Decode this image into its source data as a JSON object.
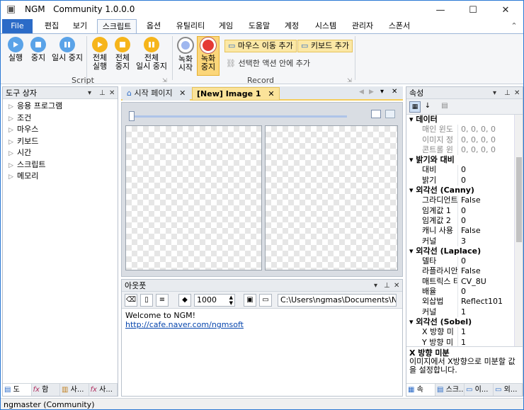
{
  "window": {
    "app_name": "NGM",
    "title": "Community 1.0.0.0",
    "minimize": "—",
    "maximize": "☐",
    "close": "✕"
  },
  "menu": {
    "file": "File",
    "tabs": [
      "편집",
      "보기",
      "스크립트",
      "옵션",
      "유틸리티",
      "게임",
      "도움말",
      "계정",
      "시스템",
      "관리자",
      "스폰서"
    ],
    "active_tab": "스크립트",
    "collapse": "⌃"
  },
  "ribbon": {
    "script_group": {
      "label": "Script",
      "buttons": [
        {
          "label": "실행"
        },
        {
          "label": "중지"
        },
        {
          "label": "일시 중지"
        },
        {
          "label": "전체\n실행"
        },
        {
          "label": "전체\n중지"
        },
        {
          "label": "전체\n일시 중지"
        }
      ]
    },
    "record_group": {
      "label": "Record",
      "record_start": "녹화\n시작",
      "record_stop": "녹화\n중지",
      "add_mouse_move": "마우스 이동 추가",
      "add_keyboard": "키보드 추가",
      "add_in_selected_action": "선택한 액션 안에 추가"
    }
  },
  "toolbox": {
    "title": "도구 상자",
    "items": [
      "응용 프로그램",
      "조건",
      "마우스",
      "키보드",
      "시간",
      "스크립트",
      "메모리"
    ],
    "bottom_tabs": [
      "도",
      "함",
      "사...",
      "사..."
    ]
  },
  "documents": {
    "tabs": [
      {
        "label": "시작 페이지"
      },
      {
        "label": "[New] Image 1"
      }
    ],
    "active": "[New] Image 1"
  },
  "output": {
    "title": "아웃풋",
    "number_value": "1000",
    "path_value": "C:\\Users\\ngmas\\Documents\\NGM5\\",
    "welcome_text": "Welcome to NGM!",
    "link_text": "http://cafe.naver.com/ngmsoft"
  },
  "properties": {
    "title": "속성",
    "categories": [
      {
        "name": "데이터",
        "rows": [
          [
            "매인 윈도",
            "0, 0, 0, 0"
          ],
          [
            "이미지 정",
            "0, 0, 0, 0"
          ],
          [
            "콘트롤 윈",
            "0, 0, 0, 0"
          ]
        ],
        "dim": true
      },
      {
        "name": "밝기와 대비",
        "rows": [
          [
            "대비",
            "0"
          ],
          [
            "밝기",
            "0"
          ]
        ]
      },
      {
        "name": "외각선 (Canny)",
        "rows": [
          [
            "그라디언트",
            "False"
          ],
          [
            "임계값 1",
            "0"
          ],
          [
            "임계값 2",
            "0"
          ],
          [
            "캐니 사용",
            "False"
          ],
          [
            "커널",
            "3"
          ]
        ]
      },
      {
        "name": "외각선 (Laplace)",
        "rows": [
          [
            "델타",
            "0"
          ],
          [
            "라플라시안",
            "False"
          ],
          [
            "매트릭스 타",
            "CV_8U"
          ],
          [
            "배율",
            "0"
          ],
          [
            "외삽법",
            "Reflect101"
          ],
          [
            "커널",
            "1"
          ]
        ]
      },
      {
        "name": "외각선 (Sobel)",
        "rows": [
          [
            "X 방향 미",
            "1"
          ],
          [
            "Y 방향 미",
            "1"
          ]
        ]
      }
    ],
    "desc_title": "X 방향 미분",
    "desc_text": "이미지에서 X방향으로 미분할 값을 설정합니다.",
    "bottom_tabs": [
      "속",
      "스크...",
      "이...",
      "외..."
    ]
  },
  "status": {
    "text": "ngmaster (Community)"
  }
}
